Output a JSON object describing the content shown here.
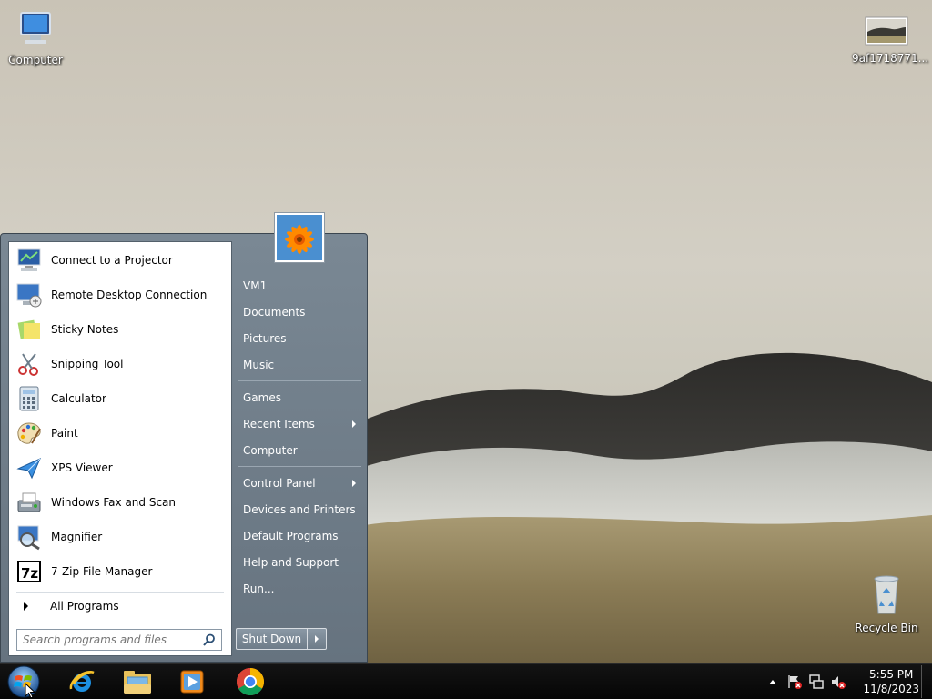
{
  "desktop": {
    "icons": [
      {
        "label": "Computer",
        "icon": "computer-icon"
      },
      {
        "label": "9af1718771...",
        "icon": "image-file-icon"
      },
      {
        "label": "Recycle Bin",
        "icon": "recycle-bin-icon"
      }
    ]
  },
  "start_menu": {
    "programs": [
      {
        "label": "Connect to a Projector",
        "icon": "projector-icon"
      },
      {
        "label": "Remote Desktop Connection",
        "icon": "remote-desktop-icon"
      },
      {
        "label": "Sticky Notes",
        "icon": "sticky-notes-icon"
      },
      {
        "label": "Snipping Tool",
        "icon": "scissors-icon"
      },
      {
        "label": "Calculator",
        "icon": "calculator-icon"
      },
      {
        "label": "Paint",
        "icon": "paint-palette-icon"
      },
      {
        "label": "XPS Viewer",
        "icon": "xps-viewer-icon"
      },
      {
        "label": "Windows Fax and Scan",
        "icon": "fax-icon"
      },
      {
        "label": "Magnifier",
        "icon": "magnifier-icon"
      },
      {
        "label": "7-Zip File Manager",
        "icon": "7zip-icon"
      }
    ],
    "all_programs": "All Programs",
    "search_placeholder": "Search programs and files",
    "right_items": [
      {
        "label": "VM1",
        "submenu": false
      },
      {
        "label": "Documents",
        "submenu": false
      },
      {
        "label": "Pictures",
        "submenu": false
      },
      {
        "label": "Music",
        "submenu": false
      },
      {
        "label": "Games",
        "submenu": false
      },
      {
        "label": "Recent Items",
        "submenu": true
      },
      {
        "label": "Computer",
        "submenu": false
      },
      {
        "label": "Control Panel",
        "submenu": true
      },
      {
        "label": "Devices and Printers",
        "submenu": false
      },
      {
        "label": "Default Programs",
        "submenu": false
      },
      {
        "label": "Help and Support",
        "submenu": false
      },
      {
        "label": "Run...",
        "submenu": false
      }
    ],
    "shutdown_label": "Shut Down"
  },
  "taskbar": {
    "pinned": [
      {
        "icon": "internet-explorer-icon"
      },
      {
        "icon": "file-explorer-icon"
      },
      {
        "icon": "media-player-icon"
      },
      {
        "icon": "chrome-icon"
      }
    ],
    "clock": {
      "time": "5:55 PM",
      "date": "11/8/2023"
    }
  },
  "colors": {
    "start_menu_bg": "#6e7c88",
    "taskbar_bg": "#0a0a0a"
  }
}
